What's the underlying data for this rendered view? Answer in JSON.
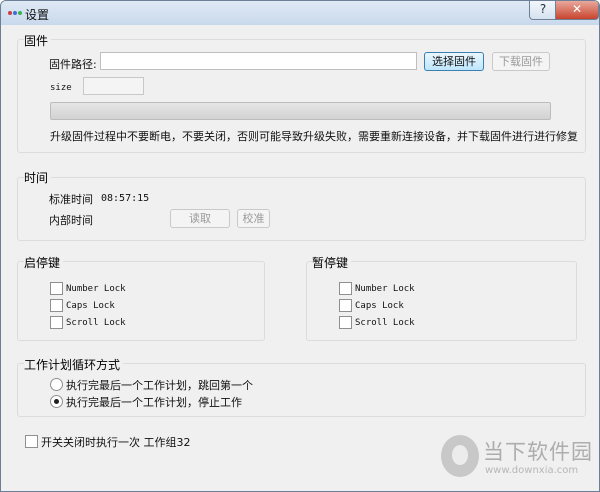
{
  "window": {
    "title": "设置",
    "help_label": "?",
    "close_label": "✕",
    "icon": "app-dots-icon"
  },
  "firmware": {
    "section_title": "固件",
    "path_label": "固件路径:",
    "path_value": "",
    "select_button": "选择固件",
    "download_button": "下载固件",
    "size_label": "size",
    "size_value": "",
    "progress": 0,
    "warning": "升级固件过程中不要断电，不要关闭，否则可能导致升级失败，需要重新连接设备，并下载固件进行进行修复"
  },
  "time": {
    "section_title": "时间",
    "standard_label": "标准时间",
    "standard_value": "08:57:15",
    "internal_label": "内部时间",
    "read_button": "读取",
    "calibrate_button": "校准"
  },
  "start_key": {
    "section_title": "启停键",
    "options": [
      {
        "label": "Number Lock",
        "checked": false
      },
      {
        "label": "Caps Lock",
        "checked": false
      },
      {
        "label": "Scroll Lock",
        "checked": false
      }
    ]
  },
  "pause_key": {
    "section_title": "暂停键",
    "options": [
      {
        "label": "Number Lock",
        "checked": false
      },
      {
        "label": "Caps Lock",
        "checked": false
      },
      {
        "label": "Scroll Lock",
        "checked": false
      }
    ]
  },
  "schedule": {
    "section_title": "工作计划循环方式",
    "options": [
      {
        "label": "执行完最后一个工作计划，跳回第一个",
        "selected": false
      },
      {
        "label": "执行完最后一个工作计划，停止工作",
        "selected": true
      }
    ]
  },
  "startup": {
    "label": "开关关闭时执行一次 工作组32",
    "checked": false
  },
  "watermark": {
    "name": "当下软件园",
    "url": "www.downxia.com"
  },
  "colors": {
    "titlebar": "#c9d9ec",
    "close": "#c7442e",
    "primary_border": "#3c7fb1"
  }
}
